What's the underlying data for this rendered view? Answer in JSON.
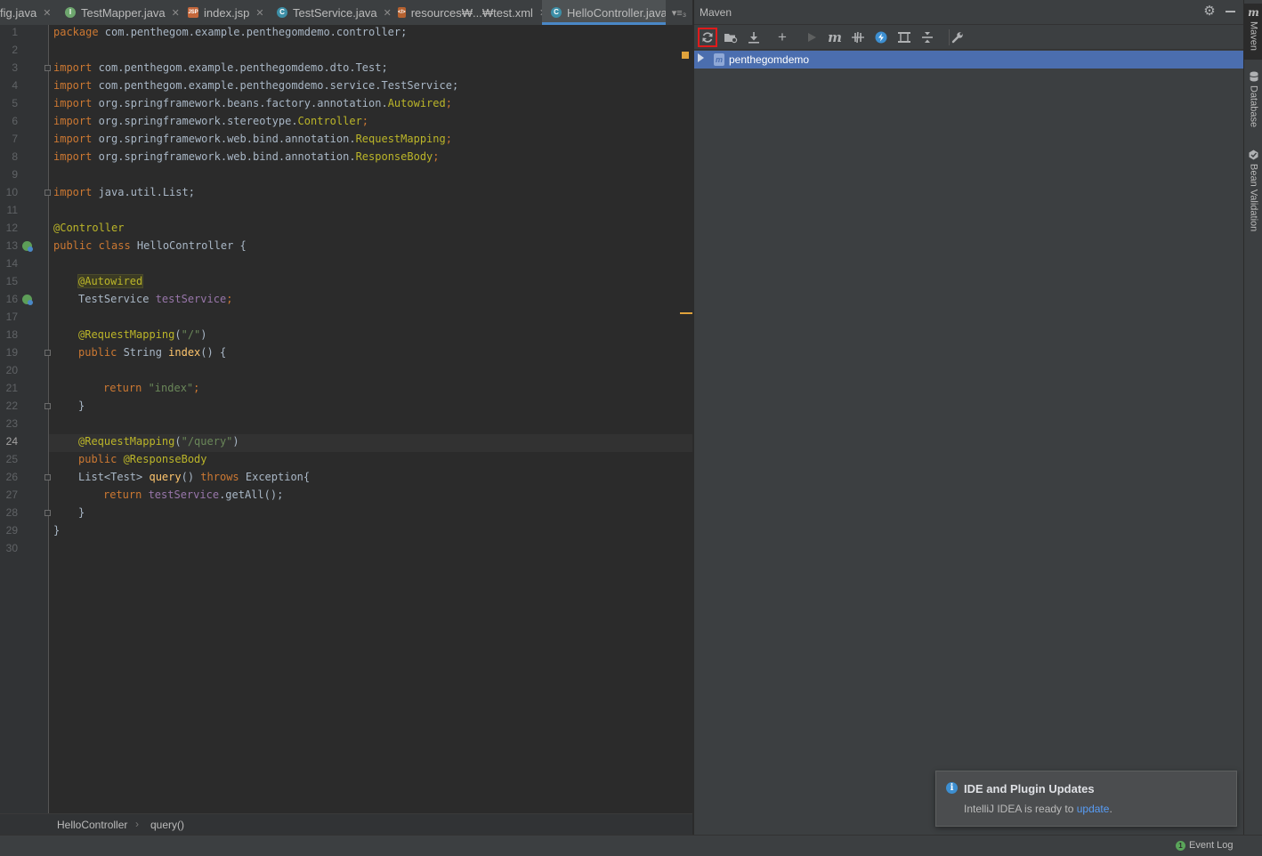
{
  "tabs": [
    {
      "label": "fig.java",
      "icon": "java-class-icon"
    },
    {
      "label": "TestMapper.java",
      "icon": "interface-icon"
    },
    {
      "label": "index.jsp",
      "icon": "jsp-icon"
    },
    {
      "label": "TestService.java",
      "icon": "class-icon"
    },
    {
      "label": "resources₩...₩test.xml",
      "icon": "xml-icon"
    },
    {
      "label": "HelloController.java",
      "icon": "class-icon"
    }
  ],
  "tab_overflow": "▾≡₃",
  "editor": {
    "line_numbers": [
      "1",
      "2",
      "3",
      "4",
      "5",
      "6",
      "7",
      "8",
      "9",
      "10",
      "11",
      "12",
      "13",
      "14",
      "15",
      "16",
      "17",
      "18",
      "19",
      "20",
      "21",
      "22",
      "23",
      "24",
      "25",
      "26",
      "27",
      "28",
      "29",
      "30"
    ],
    "lines": {
      "l1": {
        "k": "package",
        "rest": " com.penthegom.example.penthegomdemo.controller;"
      },
      "l3": {
        "k": "import",
        "rest": " com.penthegom.example.penthegomdemo.dto.Test;"
      },
      "l4": {
        "k": "import",
        "rest": " com.penthegom.example.penthegomdemo.service.TestService;"
      },
      "l5": {
        "k": "import",
        "rest": " org.springframework.beans.factory.annotation.",
        "ty": "Autowired",
        "end": ";"
      },
      "l6": {
        "k": "import",
        "rest": " org.springframework.stereotype.",
        "ty": "Controller",
        "end": ";"
      },
      "l7": {
        "k": "import",
        "rest": " org.springframework.web.bind.annotation.",
        "ty": "RequestMapping",
        "end": ";"
      },
      "l8": {
        "k": "import",
        "rest": " org.springframework.web.bind.annotation.",
        "ty": "ResponseBody",
        "end": ";"
      },
      "l10": {
        "k": "import",
        "rest": " java.util.List;"
      },
      "l12": {
        "an": "@Controller"
      },
      "l13": {
        "k": "public class",
        "rest": " HelloController {"
      },
      "l15": {
        "an": "@Autowired"
      },
      "l16": {
        "type": "TestService ",
        "fld": "testService",
        "end": ";"
      },
      "l18": {
        "an": "@RequestMapping",
        "p1": "(",
        "str": "\"/\"",
        "p2": ")"
      },
      "l19": {
        "k": "public",
        "type": " String ",
        "fn": "index",
        "end": "() {"
      },
      "l21": {
        "k": "return",
        "str": " \"index\"",
        "end": ";"
      },
      "l22": {
        "end": "}"
      },
      "l24": {
        "an": "@RequestMapping",
        "p1": "(",
        "str": "\"/query\"",
        "p2": ")"
      },
      "l25": {
        "k": "public",
        "an": " @ResponseBody"
      },
      "l26": {
        "type": "List<Test> ",
        "fn": "query",
        "mid": "() ",
        "k": "throws",
        "end": " Exception{"
      },
      "l27": {
        "k": "return",
        "fld": " testService",
        "end": ".getAll();"
      },
      "l28": {
        "end": "}"
      },
      "l29": {
        "end": "}"
      }
    }
  },
  "breadcrumb": [
    "HelloController",
    "query()"
  ],
  "maven": {
    "title": "Maven",
    "project": "penthegomdemo",
    "project_icon": "m"
  },
  "notification": {
    "title": "IDE and Plugin Updates",
    "body": "IntelliJ IDEA is ready to ",
    "link": "update",
    "end": "."
  },
  "right_tools": [
    {
      "label": "Maven",
      "icon": "m"
    },
    {
      "label": "Database"
    },
    {
      "label": "Bean Validation"
    }
  ],
  "status": {
    "event_log": "Event Log"
  }
}
